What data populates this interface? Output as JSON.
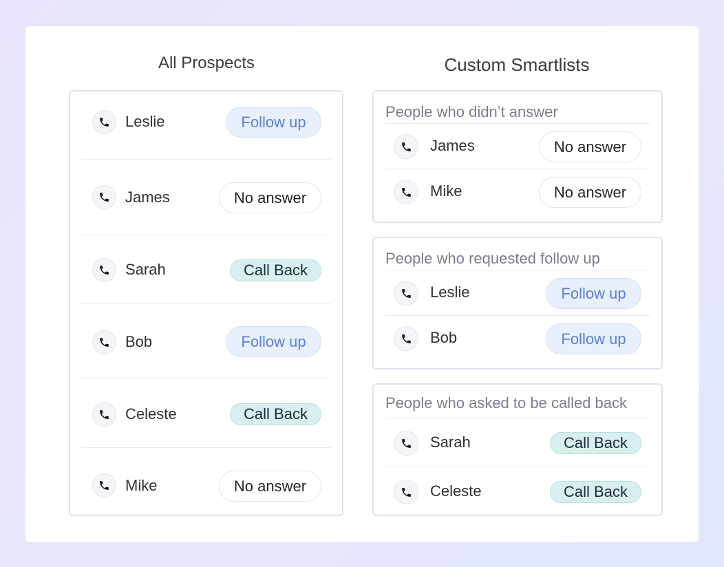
{
  "all_prospects": {
    "title": "All Prospects",
    "rows": [
      {
        "name": "Leslie",
        "status": "Follow up"
      },
      {
        "name": "James",
        "status": "No answer"
      },
      {
        "name": "Sarah",
        "status": "Call Back"
      },
      {
        "name": "Bob",
        "status": "Follow up"
      },
      {
        "name": "Celeste",
        "status": "Call Back"
      },
      {
        "name": "Mike",
        "status": "No answer"
      }
    ]
  },
  "custom_smartlists": {
    "title": "Custom Smartlists",
    "lists": [
      {
        "title": "People who didn’t answer",
        "rows": [
          {
            "name": "James",
            "status": "No answer"
          },
          {
            "name": "Mike",
            "status": "No answer"
          }
        ]
      },
      {
        "title": "People who requested follow up",
        "rows": [
          {
            "name": "Leslie",
            "status": "Follow up"
          },
          {
            "name": "Bob",
            "status": "Follow up"
          }
        ]
      },
      {
        "title": "People who asked to be called back",
        "rows": [
          {
            "name": "Sarah",
            "status": "Call Back"
          },
          {
            "name": "Celeste",
            "status": "Call Back"
          }
        ]
      }
    ]
  },
  "colors": {
    "follow_up": "#5b81d6",
    "follow_up_bg": "#e8effd",
    "call_back_bg": "#d7f0ef",
    "no_answer_bg": "#ffffff",
    "page_bg": "#e8e4fb"
  },
  "icons": {
    "row_icon": "phone-icon"
  }
}
